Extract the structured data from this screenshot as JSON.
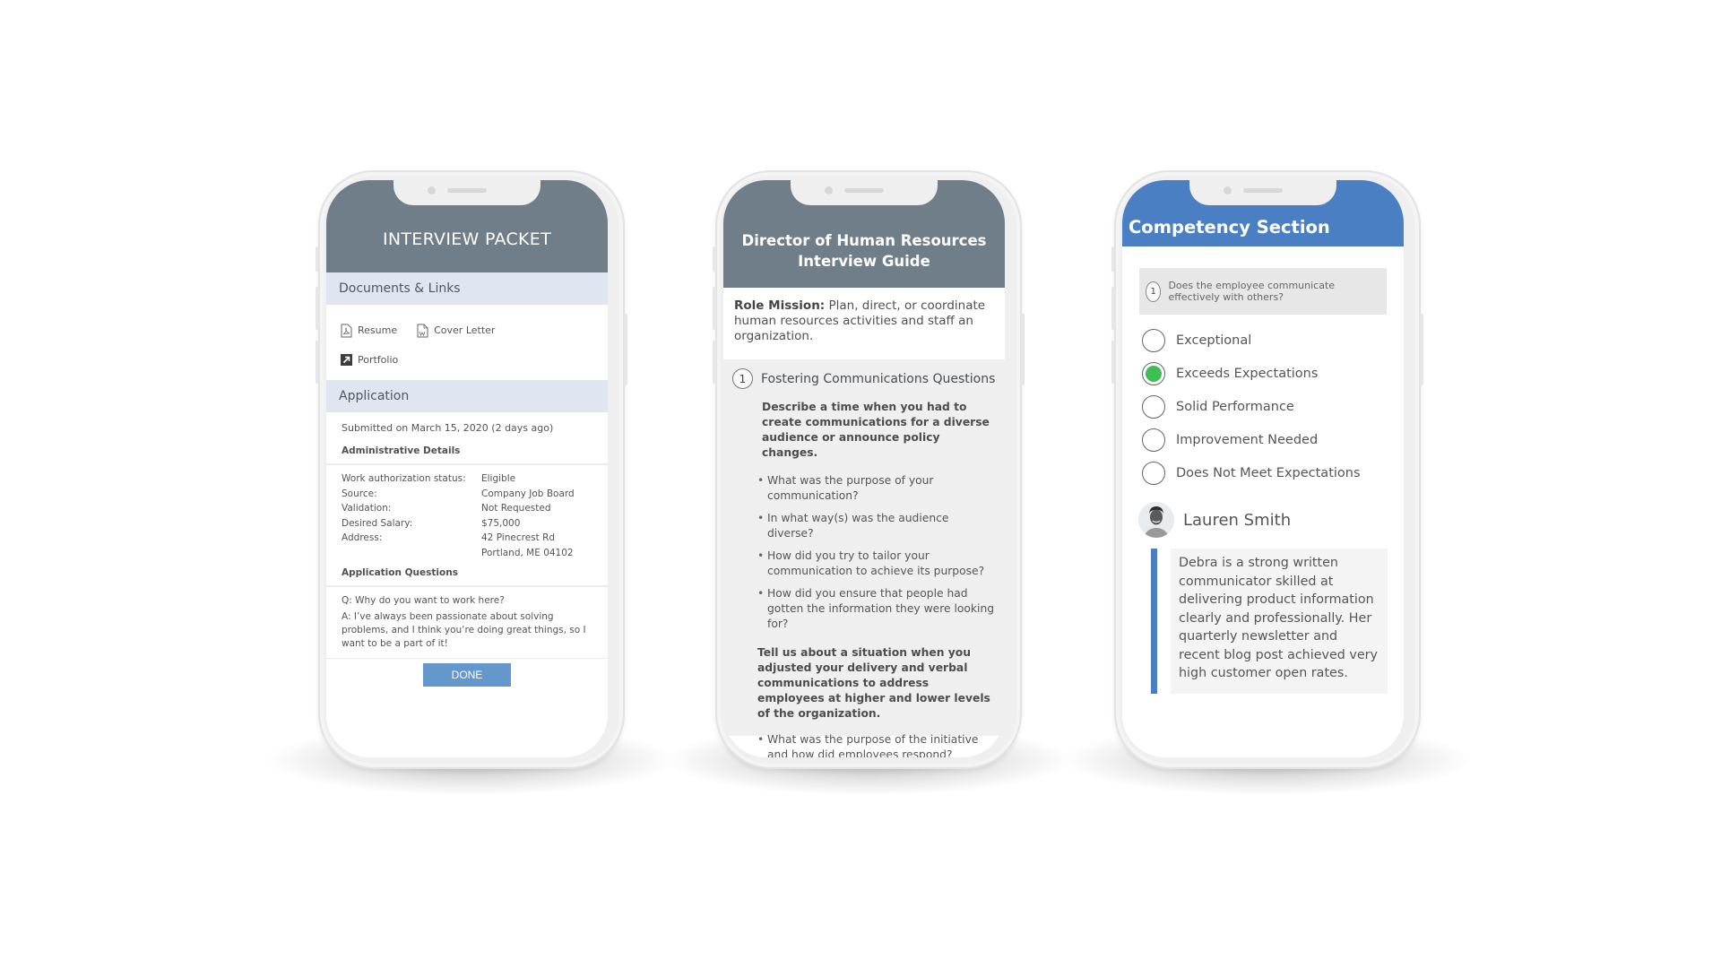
{
  "phones": {
    "interview_packet": {
      "title": "INTERVIEW PACKET",
      "documents_heading": "Documents & Links",
      "documents": [
        {
          "label": "Resume",
          "icon": "pdf-file-icon"
        },
        {
          "label": "Cover Letter",
          "icon": "word-file-icon"
        },
        {
          "label": "Portfolio",
          "icon": "external-link-icon"
        }
      ],
      "application_heading": "Application",
      "submitted": "Submitted on March 15, 2020 (2 days ago)",
      "admin_heading": "Administrative Details",
      "details": [
        {
          "label": "Work authorization status:",
          "value": "Eligible"
        },
        {
          "label": "Source:",
          "value": "Company Job Board"
        },
        {
          "label": "Validation:",
          "value": "Not Requested"
        },
        {
          "label": "Desired Salary:",
          "value": "$75,000"
        },
        {
          "label": "Address:",
          "value": "42 Pinecrest Rd"
        },
        {
          "label": "",
          "value": "Portland, ME 04102"
        }
      ],
      "questions_heading": "Application Questions",
      "question": "Q: Why do you want to work here?",
      "answer": "A: I’ve always been passionate about solving problems, and I think you’re doing great things, so I want to be a part of it!",
      "done_label": "DONE"
    },
    "interview_guide": {
      "title_line1": "Director of Human Resources",
      "title_line2": "Interview Guide",
      "mission_label": "Role Mission:",
      "mission_text": " Plan, direct, or coordinate human resources activities and staff an organization.",
      "section_number": "1",
      "section_title": "Fostering Communications Questions",
      "prompt1": "Describe a time when you had to create communications for a diverse audience or announce policy changes.",
      "prompt1_bullets": [
        "What was the purpose of your communication?",
        "In what way(s) was the audience diverse?",
        "How did you try to tailor your communication to achieve its purpose?",
        "How did you ensure that people had gotten the information they were looking for?"
      ],
      "prompt2": "Tell us about a situation when you adjusted your delivery and verbal communications to address employees at higher and lower levels of the organization.",
      "prompt2_bullets": [
        "What was the purpose of the initiative and how did employees respond?"
      ]
    },
    "competency": {
      "title": "Competency Section",
      "question_number": "1",
      "question": "Does the employee communicate effectively with others?",
      "ratings": [
        {
          "label": "Exceptional",
          "selected": false
        },
        {
          "label": "Exceeds Expectations",
          "selected": true
        },
        {
          "label": "Solid Performance",
          "selected": false
        },
        {
          "label": "Improvement Needed",
          "selected": false
        },
        {
          "label": "Does Not Meet Expectations",
          "selected": false
        }
      ],
      "reviewer_name": "Lauren Smith",
      "comment": "Debra is a strong written communicator skilled at delivering product information clearly and professionally. Her quarterly newsletter and recent blog post achieved very high customer open rates."
    }
  },
  "colors": {
    "header_gray": "#6f7e89",
    "header_blue": "#4a80c3",
    "band": "#dfe6f2",
    "done_button": "#6497cc",
    "selected_radio": "#3fbf53"
  }
}
